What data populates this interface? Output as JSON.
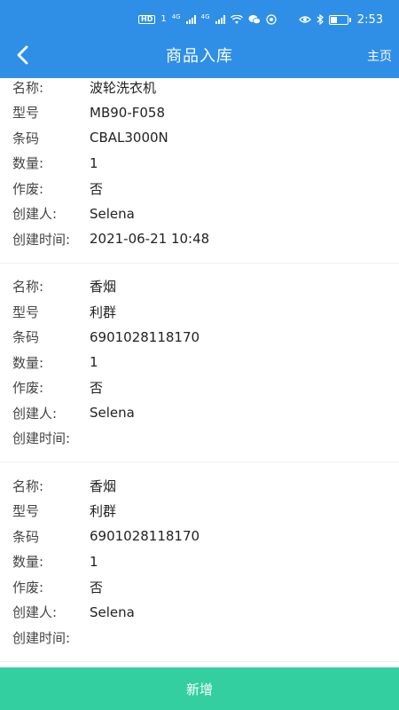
{
  "status_bar": {
    "hd": "HD",
    "sim": "1",
    "net1": "4G",
    "net2": "4G",
    "time": "2:53",
    "battery_level": 0.45
  },
  "header": {
    "title": "商品入库",
    "home_label": "主页"
  },
  "field_labels": {
    "name": "名称:",
    "model": "型号",
    "barcode": "条码",
    "quantity": "数量:",
    "void": "作废:",
    "creator": "创建人:",
    "created_time": "创建时间:"
  },
  "records": [
    {
      "name": "波轮洗衣机",
      "model": "MB90-F058",
      "barcode": "CBAL3000N",
      "quantity": "1",
      "void": "否",
      "creator": "Selena",
      "created_time": "2021-06-21 10:48"
    },
    {
      "name": "香烟",
      "model": "利群",
      "barcode": "6901028118170",
      "quantity": "1",
      "void": "否",
      "creator": "Selena",
      "created_time": ""
    },
    {
      "name": "香烟",
      "model": "利群",
      "barcode": "6901028118170",
      "quantity": "1",
      "void": "否",
      "creator": "Selena",
      "created_time": ""
    }
  ],
  "footer": {
    "add_label": "新增"
  },
  "colors": {
    "header_bg": "#2f8fe7",
    "footer_bg": "#34cfa0"
  }
}
